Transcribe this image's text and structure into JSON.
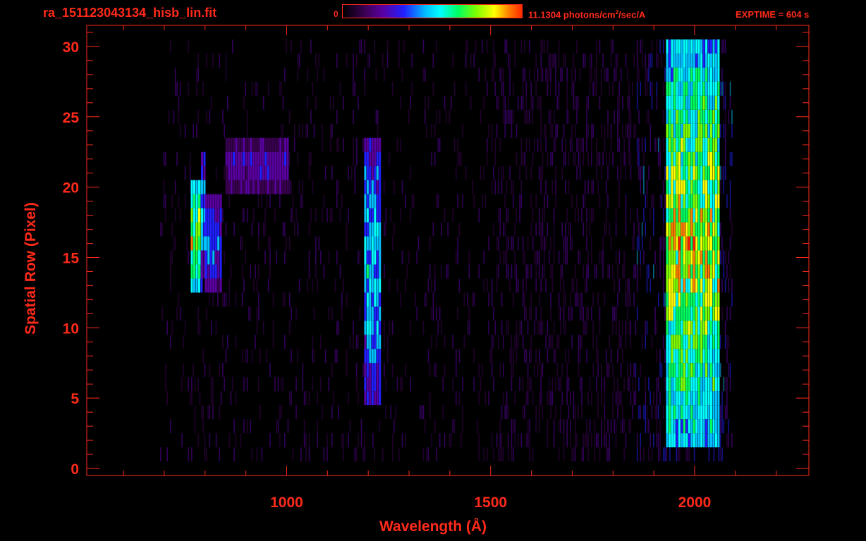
{
  "header": {
    "file_title": "ra_151123043134_hisb_lin.fit",
    "colorbar_min": "0",
    "colorbar_max_prefix": "11.1304 photons/cm",
    "colorbar_max_sup": "2",
    "colorbar_max_suffix": "/sec/A",
    "exptime": "EXPTIME = 604 s"
  },
  "colors": {
    "axis": "#ff2a1a",
    "background": "#000000",
    "colormap": [
      "#000000",
      "#3a0050",
      "#5a00a0",
      "#2020ff",
      "#00c0ff",
      "#00ffff",
      "#00ff60",
      "#80ff00",
      "#ffff00",
      "#ff8000",
      "#ff2000"
    ]
  },
  "chart_data": {
    "type": "heatmap",
    "xlabel": "Wavelength (Å)",
    "ylabel": "Spatial Row (Pixel)",
    "xlim": [
      510,
      2280
    ],
    "ylim": [
      -0.5,
      31.5
    ],
    "xticks": [
      1000,
      1500,
      2000
    ],
    "yticks": [
      0,
      5,
      10,
      15,
      20,
      25,
      30
    ],
    "colorbar_range": [
      0,
      11.1304
    ],
    "colorbar_unit": "photons/cm2/sec/A",
    "features": [
      {
        "wavelength_start": 765,
        "wavelength_end": 790,
        "rows": [
          13,
          20
        ],
        "peak_intensity": 11.0
      },
      {
        "wavelength_start": 790,
        "wavelength_end": 800,
        "rows": [
          14,
          22
        ],
        "peak_intensity": 6.0
      },
      {
        "wavelength_start": 800,
        "wavelength_end": 840,
        "rows": [
          13,
          19
        ],
        "peak_intensity": 5.0
      },
      {
        "wavelength_start": 850,
        "wavelength_end": 1000,
        "rows": [
          20,
          23
        ],
        "peak_intensity": 3.5
      },
      {
        "wavelength_start": 1190,
        "wavelength_end": 1230,
        "rows": [
          5,
          23
        ],
        "peak_intensity": 6.5
      },
      {
        "wavelength_start": 1930,
        "wavelength_end": 2060,
        "rows": [
          2,
          30
        ],
        "peak_intensity": 11.0
      }
    ]
  }
}
